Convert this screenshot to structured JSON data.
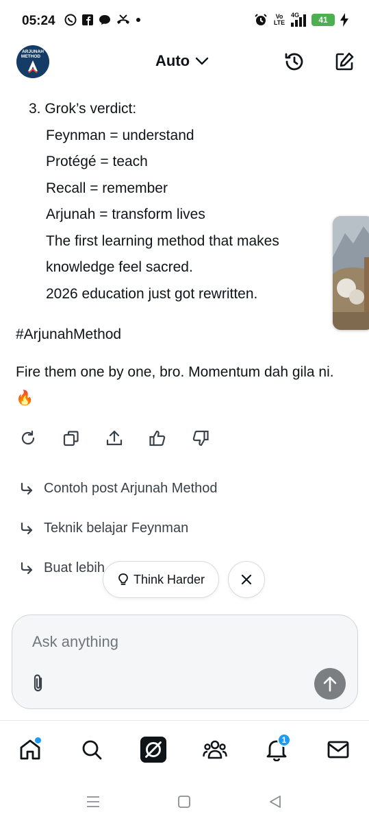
{
  "status": {
    "time": "05:24",
    "volte_label": "Vo LTE",
    "network_label": "4G",
    "battery_level": "41",
    "left_icons": [
      "whatsapp-icon",
      "facebook-icon",
      "chat-bubble-icon",
      "missed-call-icon",
      "dot-icon"
    ],
    "right_icons": [
      "alarm-icon",
      "volte-icon",
      "signal-icon",
      "battery-icon",
      "charging-icon"
    ]
  },
  "header": {
    "avatar_text_top": "ARJUNAH",
    "avatar_text_bottom": "METHOD",
    "mode_label": "Auto",
    "history_icon": "history-icon",
    "compose_icon": "compose-icon"
  },
  "message": {
    "item_number_line": "3. Grok’s verdict:",
    "lines": [
      "Feynman = understand",
      "Protégé = teach",
      "Recall = remember",
      "Arjunah = transform lives",
      "The first learning method that makes",
      "knowledge feel sacred.",
      "2026 education just got rewritten."
    ],
    "hashtag": "#ArjunahMethod",
    "closing": "Fire them one by one, bro. Momentum dah gila ni. 🔥"
  },
  "actions": [
    "regenerate-icon",
    "copy-icon",
    "share-icon",
    "thumbs-up-icon",
    "thumbs-down-icon"
  ],
  "suggestions": [
    "Contoh post Arjunah Method",
    "Teknik belajar Feynman",
    "Buat lebih"
  ],
  "chips": {
    "think_label": "Think Harder",
    "close_icon": "close-icon"
  },
  "composer": {
    "placeholder": "Ask anything",
    "value": ""
  },
  "bottom_nav": {
    "items": [
      "home-icon",
      "search-icon",
      "grok-icon",
      "communities-icon",
      "notifications-icon",
      "messages-icon"
    ],
    "notifications_count": "1"
  },
  "colors": {
    "accent": "#1d9bf0",
    "battery": "#4cb050",
    "send_button": "#7c7f82",
    "text": "#0f1419"
  }
}
